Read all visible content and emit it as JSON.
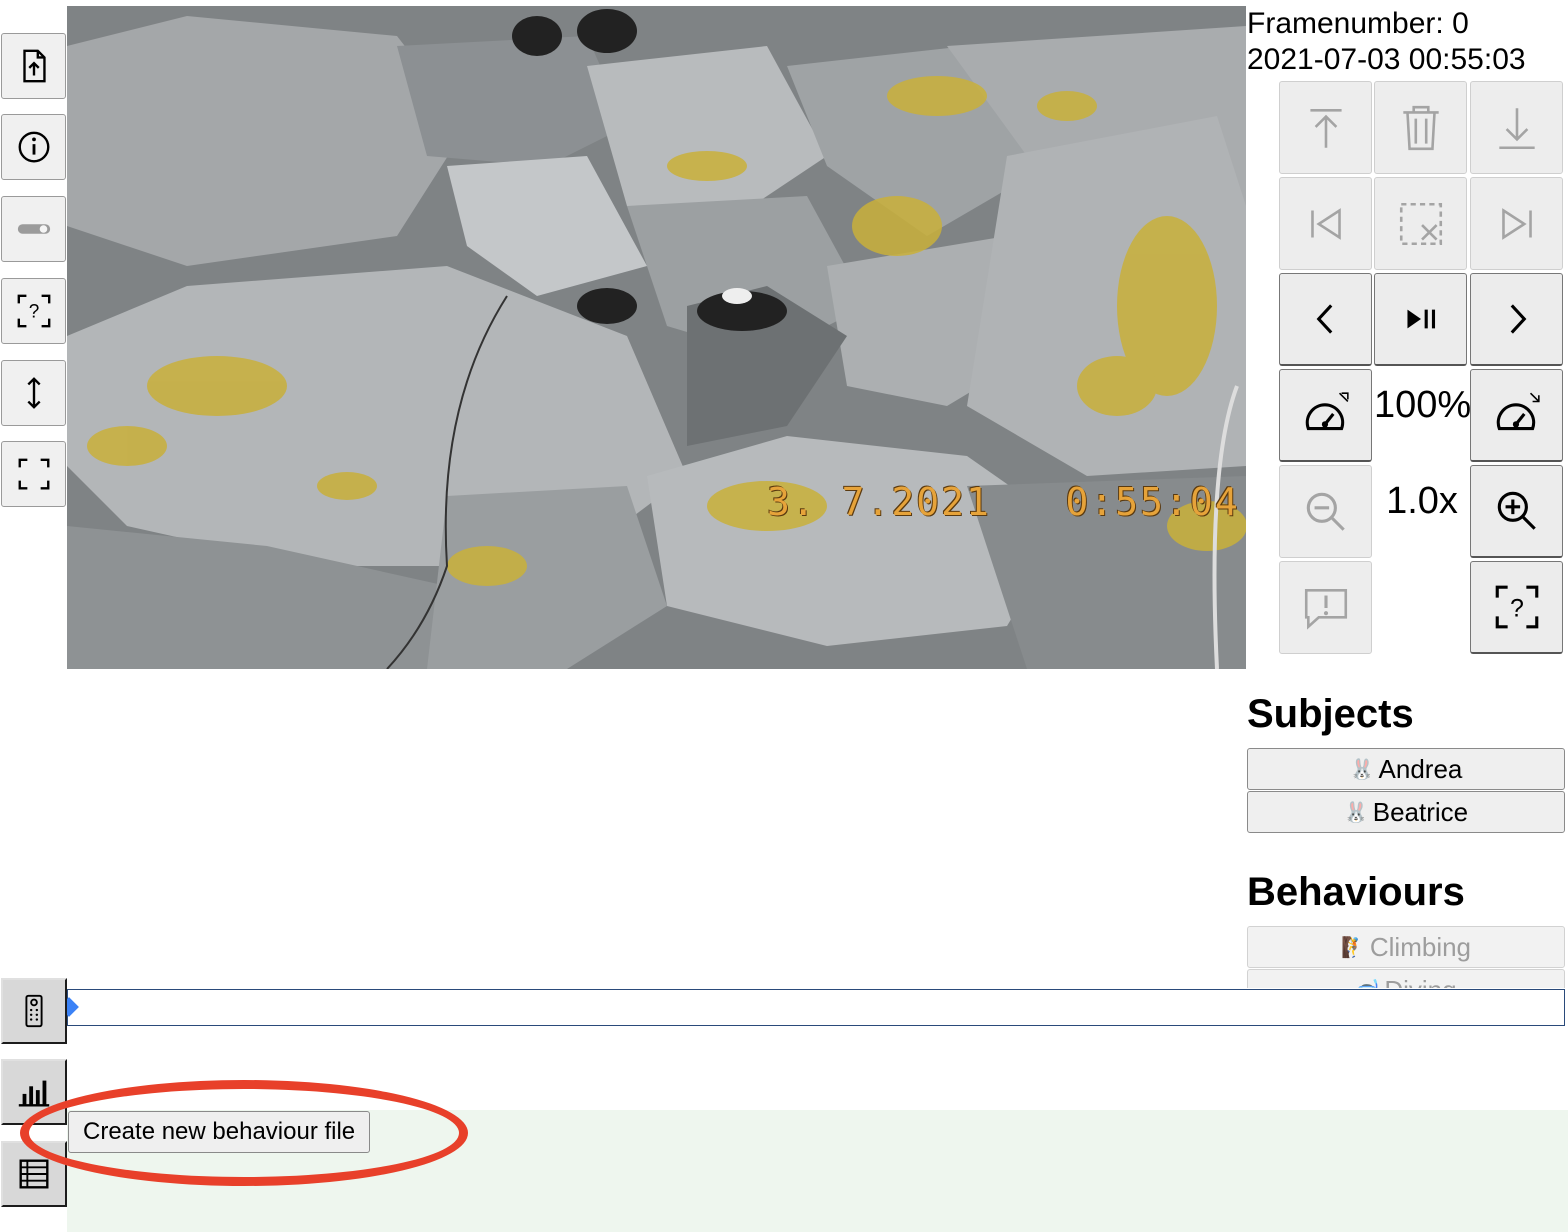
{
  "left_toolbar": {
    "buttons": [
      {
        "name": "upload-file-button",
        "icon": "file-upload-icon"
      },
      {
        "name": "info-button",
        "icon": "info-icon"
      },
      {
        "name": "toggle-button",
        "icon": "toggle-icon",
        "disabled": true
      },
      {
        "name": "help-frame-button",
        "icon": "question-frame-icon"
      },
      {
        "name": "vertical-resize-button",
        "icon": "updown-arrow-icon"
      },
      {
        "name": "fullscreen-button",
        "icon": "fullscreen-icon"
      }
    ]
  },
  "video": {
    "overlay_date": "3. 7.2021",
    "overlay_time": "0:55:04"
  },
  "frame_info": {
    "frame_label": "Framenumber: 0",
    "timestamp": "2021-07-03 00:55:03"
  },
  "controls": {
    "speed_value": "100%",
    "zoom_value": "1.0x"
  },
  "subjects": {
    "title": "Subjects",
    "items": [
      {
        "icon": "🐰",
        "label": "Andrea"
      },
      {
        "icon": "🐰",
        "label": "Beatrice"
      }
    ]
  },
  "behaviours": {
    "title": "Behaviours",
    "items": [
      {
        "icon": "🧗",
        "label": "Climbing"
      },
      {
        "icon": "🤿",
        "label": "Diving"
      }
    ]
  },
  "bottom": {
    "create_file_label": "Create new behaviour file"
  }
}
